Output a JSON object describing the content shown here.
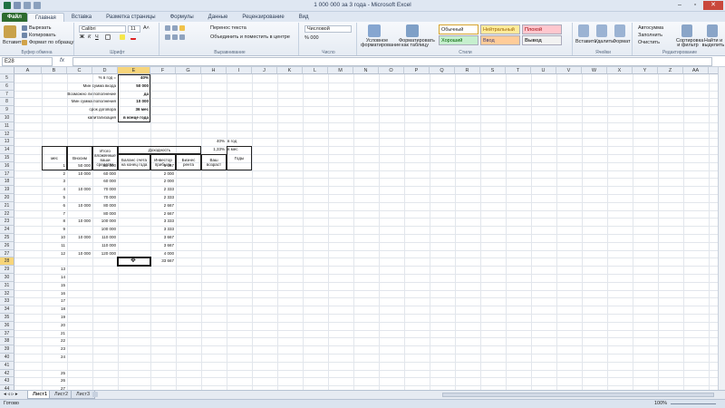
{
  "window": {
    "title": "1 000 000 за 3 года - Microsoft Excel"
  },
  "tabs": [
    "Файл",
    "Главная",
    "Вставка",
    "Разметка страницы",
    "Формулы",
    "Данные",
    "Рецензирование",
    "Вид"
  ],
  "ribbon": {
    "clipboard": {
      "cut": "Вырезать",
      "copy": "Копировать",
      "format_painter": "Формат по образцу",
      "paste": "Вставить",
      "label": "Буфер обмена"
    },
    "font": {
      "name": "Calibri",
      "size": "11",
      "label": "Шрифт"
    },
    "alignment": {
      "wrap": "Перенос текста",
      "merge": "Объединить и поместить в центре",
      "label": "Выравнивание"
    },
    "number": {
      "format": "Числовой",
      "label": "Число"
    },
    "styles": {
      "conditional": "Условное форматирование",
      "as_table": "Форматировать как таблицу",
      "cells": [
        "Обычный",
        "Нейтральный",
        "Плохой",
        "Хороший",
        "Ввод",
        "Вывод"
      ],
      "label": "Стили"
    },
    "cells": {
      "insert": "Вставить",
      "delete": "Удалить",
      "format": "Формат",
      "label": "Ячейки"
    },
    "editing": {
      "autosum": "Автосумма",
      "fill": "Заполнить",
      "clear": "Очистить",
      "sort": "Сортировка и фильтр",
      "find": "Найти и выделить",
      "label": "Редактирование"
    }
  },
  "formula_bar": {
    "name_box": "E28",
    "fx": "fx",
    "value": ""
  },
  "columns": [
    "A",
    "B",
    "C",
    "D",
    "E",
    "F",
    "G",
    "H",
    "I",
    "J",
    "K",
    "L",
    "M",
    "N",
    "O",
    "P",
    "Q",
    "R",
    "S",
    "T",
    "U",
    "V",
    "W",
    "X",
    "Y",
    "Z",
    "AA",
    "AB"
  ],
  "rows": [
    "5",
    "6",
    "7",
    "8",
    "9",
    "10",
    "11",
    "12",
    "13",
    "14",
    "15",
    "16",
    "17",
    "18",
    "19",
    "20",
    "21",
    "22",
    "23",
    "24",
    "25",
    "26",
    "27",
    "28",
    "29",
    "30",
    "31",
    "32",
    "33",
    "34",
    "35",
    "36",
    "37",
    "38",
    "39",
    "40",
    "41",
    "42",
    "43",
    "44"
  ],
  "params": [
    {
      "label": "% в год =",
      "value": "40%"
    },
    {
      "label": "Мин сумма вкода",
      "value": "50 000"
    },
    {
      "label": "Возможно ли пополнение",
      "value": "да"
    },
    {
      "label": "Мин сумма пополнения",
      "value": "10 000"
    },
    {
      "label": "срок договора",
      "value": "36 мес"
    },
    {
      "label": "капитализация",
      "value": "в конце года"
    }
  ],
  "rate": {
    "annual": "40%",
    "annual_label": "в год",
    "monthly": "1,33%",
    "monthly_label": "в мес"
  },
  "table_head": {
    "month": "мес",
    "deposit": "Вносим",
    "total": "Итого вложенные ваши средства",
    "income": "Доходность",
    "balance": "Баланс счета на конец года",
    "invest": "Инвестор прибыль",
    "business": "Бизнес рента",
    "age": "Ваш возраст",
    "years": "Годы"
  },
  "table_rows": [
    {
      "m": "1",
      "d": "50 000",
      "t": "50 000",
      "p": "1 667"
    },
    {
      "m": "2",
      "d": "10 000",
      "t": "60 000",
      "p": "2 000"
    },
    {
      "m": "3",
      "d": "",
      "t": "60 000",
      "p": "2 000"
    },
    {
      "m": "4",
      "d": "10 000",
      "t": "70 000",
      "p": "2 333"
    },
    {
      "m": "5",
      "d": "",
      "t": "70 000",
      "p": "2 333"
    },
    {
      "m": "6",
      "d": "10 000",
      "t": "80 000",
      "p": "2 667"
    },
    {
      "m": "7",
      "d": "",
      "t": "80 000",
      "p": "2 667"
    },
    {
      "m": "8",
      "d": "10 000",
      "t": "100 000",
      "p": "3 333"
    },
    {
      "m": "9",
      "d": "",
      "t": "100 000",
      "p": "3 333"
    },
    {
      "m": "10",
      "d": "10 000",
      "t": "110 000",
      "p": "3 667"
    },
    {
      "m": "11",
      "d": "",
      "t": "110 000",
      "p": "3 667"
    },
    {
      "m": "12",
      "d": "10 000",
      "t": "120 000",
      "p": "4 000"
    }
  ],
  "total_profit": "33 667",
  "extra_months": [
    "13",
    "14",
    "15",
    "16",
    "17",
    "18",
    "19",
    "20",
    "21",
    "22",
    "23",
    "24",
    "",
    "25",
    "26",
    "27"
  ],
  "sheets": [
    "Лист1",
    "Лист2",
    "Лист3"
  ],
  "status": {
    "ready": "Готово",
    "zoom": "100%"
  }
}
